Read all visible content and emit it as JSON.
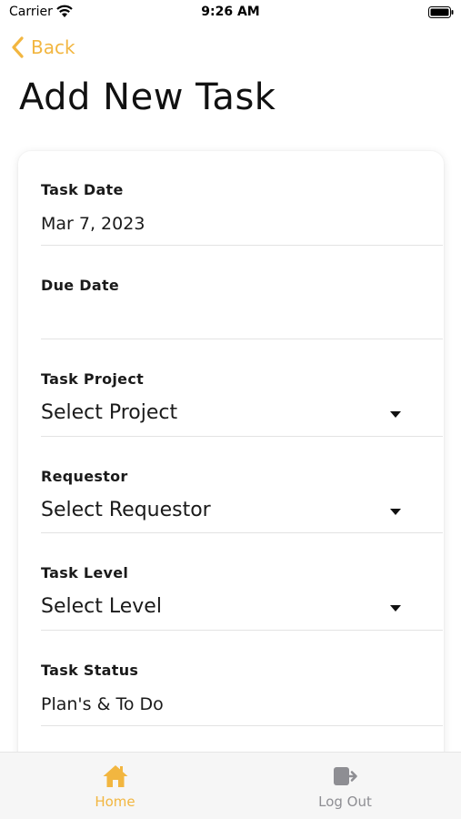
{
  "status_bar": {
    "carrier": "Carrier",
    "time": "9:26 AM"
  },
  "nav": {
    "back_label": "Back"
  },
  "page": {
    "title": "Add New Task"
  },
  "form": {
    "task_date": {
      "label": "Task Date",
      "value": "Mar 7, 2023"
    },
    "due_date": {
      "label": "Due Date",
      "value": ""
    },
    "task_project": {
      "label": "Task Project",
      "value": "Select Project"
    },
    "requestor": {
      "label": "Requestor",
      "value": "Select Requestor"
    },
    "task_level": {
      "label": "Task Level",
      "value": "Select Level"
    },
    "task_status": {
      "label": "Task Status",
      "value": "Plan's & To Do"
    }
  },
  "tab_bar": {
    "items": [
      {
        "label": "Home",
        "icon": "home-icon",
        "active": true
      },
      {
        "label": "Log Out",
        "icon": "logout-icon",
        "active": false
      }
    ]
  },
  "colors": {
    "accent": "#f2b640",
    "inactive": "#8e8e93"
  }
}
